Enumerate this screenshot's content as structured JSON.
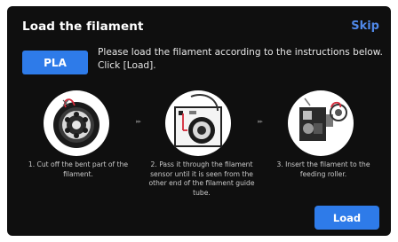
{
  "dialog": {
    "title": "Load the filament",
    "skip_label": "Skip"
  },
  "filament": {
    "type_label": "PLA"
  },
  "instruction": "Please load the filament according to the instructions below. Click [Load].",
  "steps": [
    {
      "caption": "1. Cut off the bent part  of the filament.",
      "icon": "filament-spool-icon"
    },
    {
      "caption": "2. Pass it through the filament sensor until it is seen from the other end of the filament guide tube.",
      "icon": "filament-sensor-icon"
    },
    {
      "caption": "3. Insert the filament to the feeding roller.",
      "icon": "extruder-feeder-icon"
    }
  ],
  "actions": {
    "load_label": "Load"
  },
  "colors": {
    "accent": "#2e7be9",
    "background": "#0f0f0f",
    "filament": "#d42a3a"
  }
}
